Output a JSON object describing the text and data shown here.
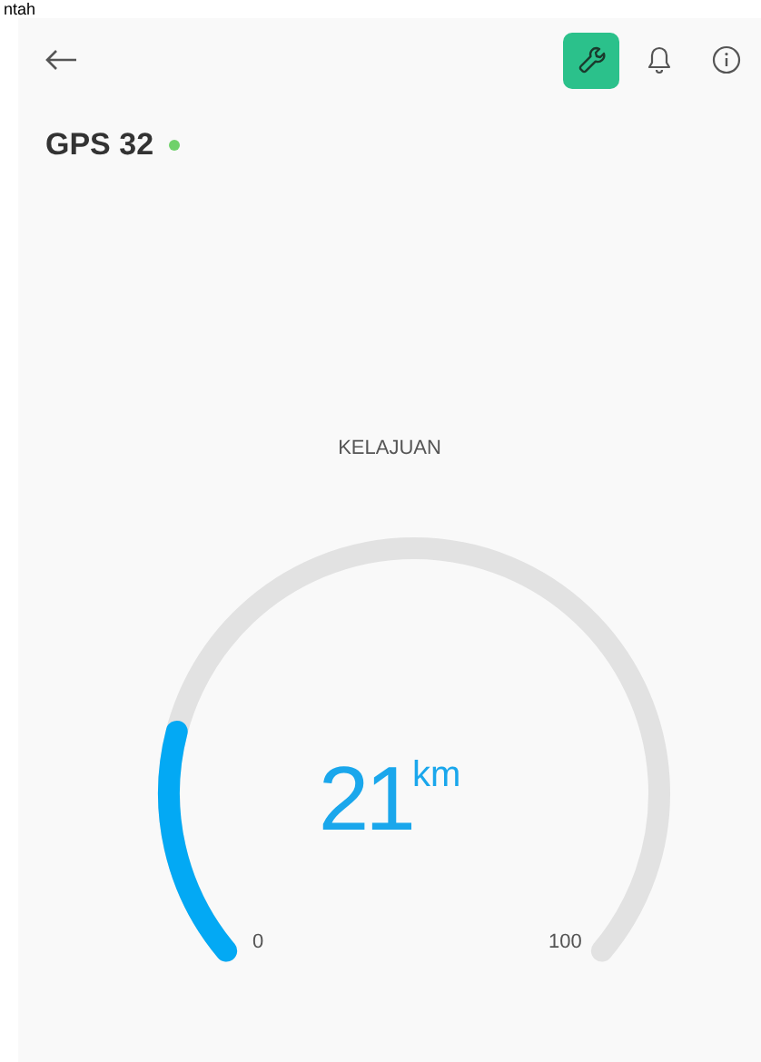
{
  "top_text": "ntah",
  "toolbar": [
    {
      "kind": "wrench",
      "active": true
    },
    {
      "kind": "bell",
      "active": false
    },
    {
      "kind": "info",
      "active": false
    }
  ],
  "device": {
    "name": "GPS 32",
    "online": true
  },
  "gauge": {
    "label": "KELAJUAN",
    "value": "21",
    "unit": "km",
    "level": 0.21,
    "min_label": "0",
    "max_label": "100"
  }
}
